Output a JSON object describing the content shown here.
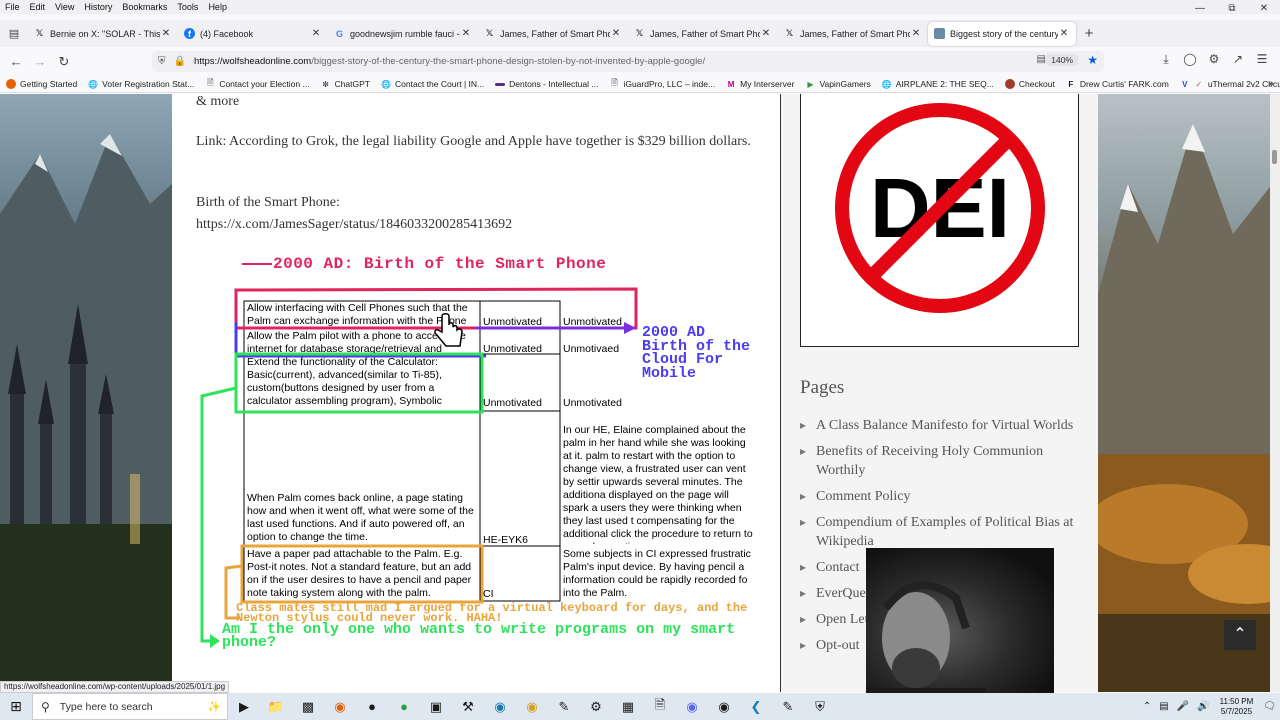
{
  "menubar": {
    "items": [
      "File",
      "Edit",
      "View",
      "History",
      "Bookmarks",
      "Tools",
      "Help"
    ]
  },
  "window_controls": {
    "minimize": "—",
    "maximize": "⧉",
    "close": "✕"
  },
  "tabs": [
    {
      "label": "Bernie on X: \"SOLAR - This is Sp",
      "icon": "x-logo-icon",
      "close": "✕"
    },
    {
      "label": "(4) Facebook",
      "icon": "facebook-icon",
      "close": "✕"
    },
    {
      "label": "goodnewsjim rumble fauci - Go",
      "icon": "google-icon",
      "close": "✕"
    },
    {
      "label": "James, Father of Smart Phone, #",
      "icon": "x-logo-icon",
      "close": "✕"
    },
    {
      "label": "James, Father of Smart Phone, #",
      "icon": "x-logo-icon",
      "close": "✕"
    },
    {
      "label": "James, Father of Smart Phone, #",
      "icon": "x-logo-icon",
      "close": "✕"
    },
    {
      "label": "Biggest story of the century! Th",
      "icon": "page-icon",
      "close": "✕"
    }
  ],
  "newtab": "+",
  "url": {
    "host": "https://wolfsheadonline.com",
    "path": "/biggest-story-of-the-century-the-smart-phone-design-stolen-by-not-invented-by-apple-google/",
    "zoom": "140%"
  },
  "bookmarks": [
    {
      "label": "Getting Started",
      "icon": "firefox-icon",
      "color": "#e66000"
    },
    {
      "label": "Voter Registration Stat...",
      "icon": "globe-icon",
      "color": "#555555"
    },
    {
      "label": "Contact your Election ...",
      "icon": "document-icon",
      "color": "#555555"
    },
    {
      "label": "ChatGPT",
      "icon": "chatgpt-icon",
      "color": "#333333"
    },
    {
      "label": "Contact the Court | IN...",
      "icon": "globe-icon",
      "color": "#555555"
    },
    {
      "label": "Dentons - Intellectual ...",
      "icon": "dentons-icon",
      "color": "#5a2d82"
    },
    {
      "label": "iGuardPro, LLC – inde...",
      "icon": "document-icon",
      "color": "#555555"
    },
    {
      "label": "My Interserver",
      "icon": "interserver-icon",
      "color": "#b0008e"
    },
    {
      "label": "VapinGamers",
      "icon": "vapingamers-icon",
      "color": "#2a9d3a"
    },
    {
      "label": "AIRPLANE 2: THE SEQ...",
      "icon": "globe-icon",
      "color": "#555555"
    },
    {
      "label": "Checkout",
      "icon": "checkout-icon",
      "color": "#a33a2a"
    },
    {
      "label": "Drew Curtis' FARK.com",
      "icon": "fark-icon",
      "color": "#333333"
    },
    {
      "label": "uThermal 2v2 Circuit - ...",
      "icon": "uthermal-icon",
      "color": "#d33"
    }
  ],
  "bookmarks_more": "»",
  "article": {
    "and_more": "& more",
    "link_text": "Link: According to Grok, the legal liability Google and Apple have together is $329 billion dollars.",
    "birth_label": "Birth of the Smart Phone:",
    "birth_url": "https://x.com/JamesSager/status/1846033200285413692"
  },
  "figure": {
    "title": "2000 AD: Birth of the Smart Phone",
    "rows": [
      {
        "feature": "Allow interfacing with Cell Phones such that the Palm can exchange information with the Phone",
        "col2": "Unmotivated",
        "col3": "Unmotivated"
      },
      {
        "feature": "Allow the Palm pilot with a phone to access the internet for database storage/retrieval and",
        "col2": "Unmotivated",
        "col3": "Unmotivaed"
      },
      {
        "feature": "Extend the functionality of the Calculator: Basic(current), advanced(similar to Ti-85), custom(buttons designed by user from a calculator assembling program), Symbolic",
        "col2": "Unmotivated",
        "col3": "Unmotivated"
      },
      {
        "feature": "When Palm comes back online, a page stating how and when it went off, what were some of the last used functions. And if auto powered off, an option to change the time.",
        "col2": "HE-EYK6",
        "col3": "In our HE, Elaine complained about the palm in her hand while she was looking at it. palm to restart with the option to change view, a frustrated user can vent by settir upwards several minutes. The additiona displayed on the page will spark a users they were thinking when they last used t compensating for the additional click the procedure to return to normal operating m"
      },
      {
        "feature": "Have a paper pad attachable to the Palm. E.g. Post-it notes. Not a standard feature, but an add on if the user desires to have a pencil and paper note taking system along with the palm.",
        "col2": "CI",
        "col3": "Some subjects in CI expressed frustratic Palm's input device. By having pencil a information could be rapidly recorded fo into the Palm."
      }
    ],
    "cloud_note": "2000 AD Birth of the Cloud For Mobile",
    "keyboard_note": "Class mates still mad I argued for a virtual keyboard for days, and the Newton stylus could never work. HAHA!",
    "program_note": "Am I the only one who wants to write programs on my smart phone?"
  },
  "sidebar": {
    "dei_text": "DEI",
    "pages_title": "Pages",
    "pages": [
      "A Class Balance Manifesto for Virtual Worlds",
      "Benefits of Receiving Holy Communion Worthily",
      "Comment Policy",
      "Compendium of Examples of Political Bias at Wikipedia",
      "Contact",
      "EverQuest",
      "Open Letter to the Guild Su",
      "Opt-out"
    ]
  },
  "status_url": "https://wolfsheadonline.com/wp-content/uploads/2025/01/1.jpg",
  "taskbar": {
    "search_placeholder": "Type here to search",
    "time": "11:50 PM",
    "date": "5/7/2025"
  },
  "colors": {
    "accent": "#0060df",
    "fig_pink": "#e0245e",
    "fig_blue": "#4a3cf0",
    "fig_green": "#2ee35a",
    "fig_orange": "#e8a53c",
    "fig_purple": "#7a2fe0"
  }
}
